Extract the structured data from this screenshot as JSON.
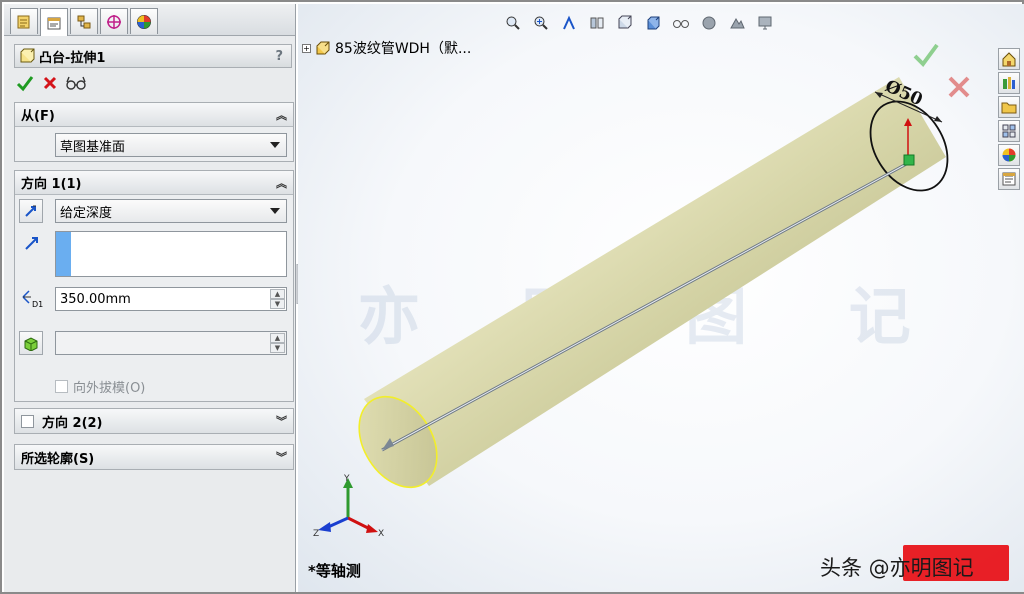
{
  "property_manager": {
    "tabs": [
      "feature-manager",
      "property-manager",
      "configuration-manager",
      "dimxpert-manager",
      "display-manager"
    ],
    "title": "凸台-拉伸1",
    "help": "?",
    "from_group": {
      "label": "从(F)",
      "start_condition": "草图基准面"
    },
    "direction1_group": {
      "label": "方向 1(1)",
      "end_condition": "给定深度",
      "depth": "350.00mm",
      "draft_outward_label": "向外拔模(O)"
    },
    "direction2_group": {
      "label": "方向 2(2)"
    },
    "selected_contours_group": {
      "label": "所选轮廓(S)"
    }
  },
  "viewport": {
    "tree_node_label": "85波纹管WDH（默...",
    "dimension_label": "Ø50",
    "dim_diameter_symbol": "Ø",
    "dim_value": "50",
    "view_name": "*等轴测",
    "triad": {
      "x": "X",
      "y": "Y",
      "z": "Z"
    },
    "watermark_text": "头条 @亦明图记",
    "colors": {
      "cylinder_body": "#d6d5a6",
      "cylinder_edge": "#f2ee2a",
      "accept_green": "#6cc26c",
      "cancel_red": "#e06a6a",
      "stamp_red": "#e8141a"
    }
  }
}
